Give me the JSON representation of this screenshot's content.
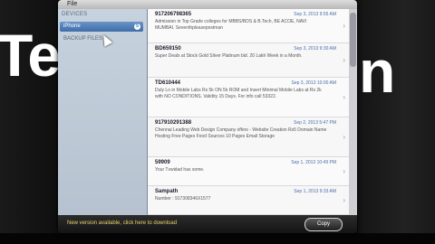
{
  "background": {
    "left_text": "Te",
    "right_text": "n"
  },
  "menu": {
    "file_label": "File"
  },
  "sidebar": {
    "heading": "DEVICES",
    "items": [
      {
        "label": "iPhone",
        "badge": "5"
      },
      {
        "label": "BACKUP FILES"
      }
    ]
  },
  "messages": [
    {
      "sender": "917206798365",
      "date": "Sep 3, 2013 9:55 AM",
      "body": "Admission in Top Grade colleges for MBBS/BDS & B.Tech, BE ACOE, NAVI MUMBAI. Seventhpleasepostman"
    },
    {
      "sender": "BD659150",
      "date": "Sep 3, 2013 9:30 AM",
      "body": "Super Deals at Stock Gold Silver Platinum bid. 20 Lakh Week in a Month."
    },
    {
      "sender": "TD610444",
      "date": "Sep 3, 2013 10:00 AM",
      "body": "Duly Lo in Mobile Labs Rs 5k ON 5k ROM and Insert Minimal Mobile Labs at Rs 2k with NO CONDITIONS. Validity 15 Days. For info call 53322."
    },
    {
      "sender": "917910291388",
      "date": "Sep 2, 2013 5:47 PM",
      "body": "Chennai Leading Web Design Company offers - Website Creation Rs5 Domain Name Hosting Free Pages Food Sources 10 Pages Email Storage"
    },
    {
      "sender": "59909",
      "date": "Sep 1, 2013 10:49 PM",
      "body": "Your Tvwidad has some."
    },
    {
      "sender": "Sampath",
      "date": "Sep 1, 2013 9:33 AM",
      "body": "Number : 917308346X1577"
    }
  ],
  "status": {
    "update_text": "New version available, click here to download",
    "copy_label": "Copy"
  }
}
